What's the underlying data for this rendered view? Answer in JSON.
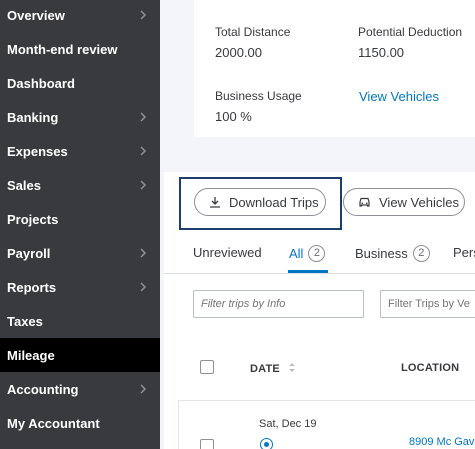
{
  "sidebar": {
    "items": [
      {
        "label": "Overview",
        "has_chevron": true,
        "active": false
      },
      {
        "label": "Month-end review",
        "has_chevron": false,
        "active": false
      },
      {
        "label": "Dashboard",
        "has_chevron": false,
        "active": false
      },
      {
        "label": "Banking",
        "has_chevron": true,
        "active": false
      },
      {
        "label": "Expenses",
        "has_chevron": true,
        "active": false
      },
      {
        "label": "Sales",
        "has_chevron": true,
        "active": false
      },
      {
        "label": "Projects",
        "has_chevron": false,
        "active": false
      },
      {
        "label": "Payroll",
        "has_chevron": true,
        "active": false
      },
      {
        "label": "Reports",
        "has_chevron": true,
        "active": false
      },
      {
        "label": "Taxes",
        "has_chevron": false,
        "active": false
      },
      {
        "label": "Mileage",
        "has_chevron": false,
        "active": true
      },
      {
        "label": "Accounting",
        "has_chevron": true,
        "active": false
      },
      {
        "label": "My Accountant",
        "has_chevron": false,
        "active": false
      }
    ]
  },
  "summary": {
    "total_distance_label": "Total Distance",
    "total_distance_value": "2000.00",
    "potential_deduction_label": "Potential Deduction",
    "potential_deduction_value": "1150.00",
    "business_usage_label": "Business Usage",
    "business_usage_value": "100 %",
    "view_vehicles_link": "View Vehicles"
  },
  "actions": {
    "download_trips_label": "Download Trips",
    "view_vehicles_label": "View Vehicles"
  },
  "tabs": [
    {
      "label": "Unreviewed",
      "count": null,
      "active": false
    },
    {
      "label": "All",
      "count": "2",
      "active": true
    },
    {
      "label": "Business",
      "count": "2",
      "active": false
    },
    {
      "label": "Pers",
      "count": null,
      "active": false
    }
  ],
  "filters": {
    "info_placeholder": "Filter trips by Info",
    "vehicle_placeholder": "Filter Trips by Ve"
  },
  "table": {
    "col_date": "DATE",
    "col_location": "LOCATION"
  },
  "row": {
    "date": "Sat, Dec 19",
    "location": "8909 Mc Gav"
  },
  "colors": {
    "sidebar_bg": "#393a3d",
    "active_item_bg": "#000000",
    "link_blue": "#0077c5",
    "page_bg": "#f4f5f8",
    "highlight_border": "#1d3f6e"
  }
}
